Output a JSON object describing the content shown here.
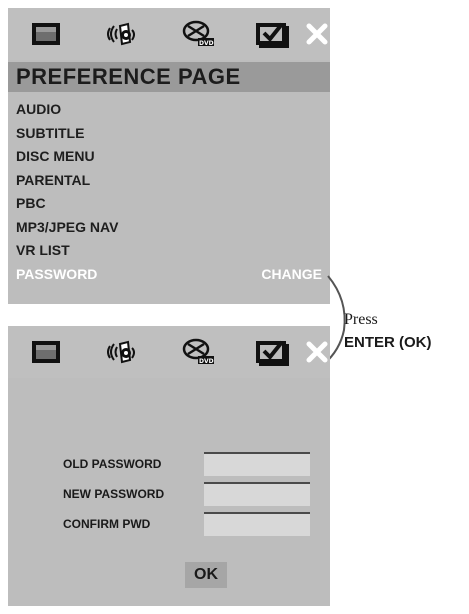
{
  "colors": {
    "panel_bg": "#bdbdbd",
    "title_bar": "#9a9a9a",
    "highlight_text": "#ffffff",
    "text": "#1e1e1e"
  },
  "icon_bar": [
    {
      "icon": "screen-setup-icon"
    },
    {
      "icon": "audio-setup-icon"
    },
    {
      "icon": "video-setup-icon"
    },
    {
      "icon": "preference-setup-icon"
    },
    {
      "icon": "close-icon"
    }
  ],
  "preference_page": {
    "title": "PREFERENCE PAGE",
    "items": [
      {
        "label": "AUDIO",
        "value": ""
      },
      {
        "label": "SUBTITLE",
        "value": ""
      },
      {
        "label": "DISC MENU",
        "value": ""
      },
      {
        "label": "PARENTAL",
        "value": ""
      },
      {
        "label": "PBC",
        "value": ""
      },
      {
        "label": "MP3/JPEG NAV",
        "value": ""
      },
      {
        "label": "VR LIST",
        "value": ""
      },
      {
        "label": "PASSWORD",
        "value": "CHANGE"
      }
    ],
    "selected_index": 7
  },
  "instruction": {
    "press": "Press",
    "key": "ENTER (OK)"
  },
  "password_page": {
    "fields": [
      {
        "label": "OLD PASSWORD",
        "value": ""
      },
      {
        "label": "NEW PASSWORD",
        "value": ""
      },
      {
        "label": "CONFIRM PWD",
        "value": ""
      }
    ],
    "ok_label": "OK"
  }
}
